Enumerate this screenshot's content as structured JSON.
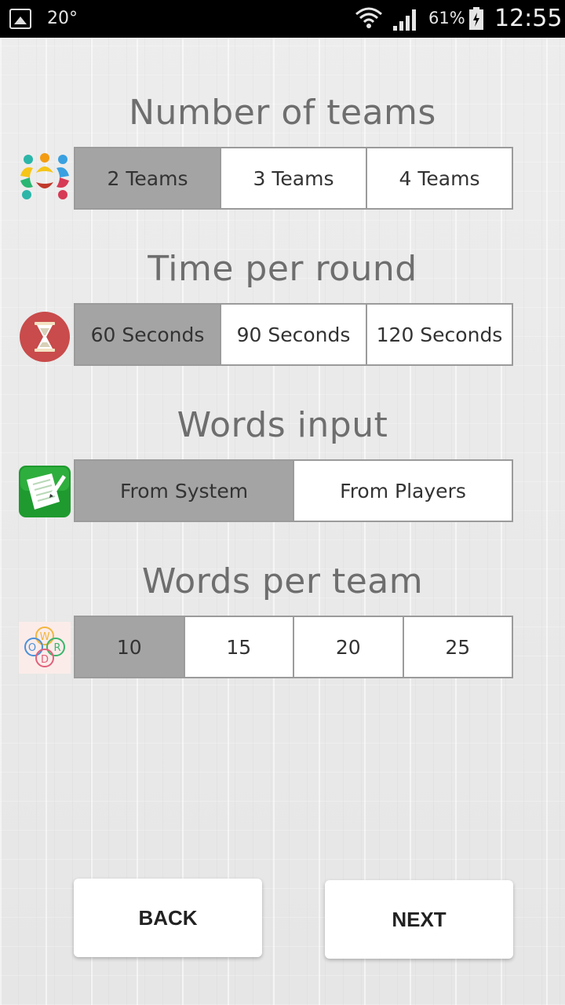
{
  "status_bar": {
    "temperature": "20°",
    "battery_percent": "61%",
    "time": "12:55"
  },
  "sections": {
    "teams": {
      "title": "Number of teams",
      "icon": "teams-icon",
      "options": [
        "2 Teams",
        "3 Teams",
        "4 Teams"
      ],
      "selected": "2 Teams"
    },
    "time": {
      "title": "Time per round",
      "icon": "hourglass-icon",
      "options": [
        "60 Seconds",
        "90 Seconds",
        "120 Seconds"
      ],
      "selected": "60 Seconds"
    },
    "words_input": {
      "title": "Words input",
      "icon": "notes-icon",
      "options": [
        "From System",
        "From Players"
      ],
      "selected": "From System"
    },
    "words_per_team": {
      "title": "Words per team",
      "icon": "word-logo-icon",
      "logo_letters": [
        "W",
        "O",
        "R",
        "D"
      ],
      "options": [
        "10",
        "15",
        "20",
        "25"
      ],
      "selected": "10"
    }
  },
  "buttons": {
    "back": "BACK",
    "next": "NEXT"
  },
  "colors": {
    "selected_segment": "#a4a4a4",
    "title_text": "#6e6e6e",
    "status_bar": "#000000"
  }
}
